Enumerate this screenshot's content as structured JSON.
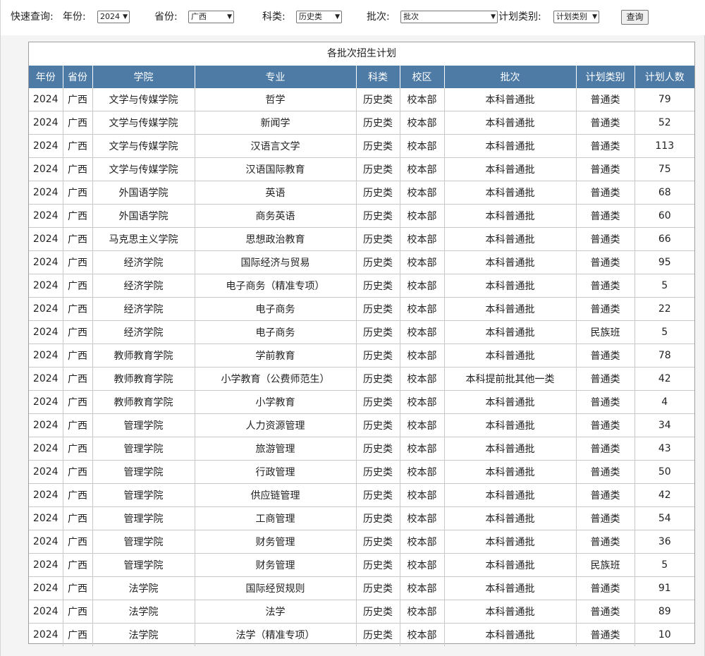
{
  "filter": {
    "quick_label": "快速查询:",
    "year_label": "年份:",
    "year_value": "2024",
    "province_label": "省份:",
    "province_value": "广西",
    "subject_label": "科类:",
    "subject_value": "历史类",
    "batch_label": "批次:",
    "batch_value": "批次",
    "plan_type_label": "计划类别:",
    "plan_type_value": "计划类别",
    "query_button": "查询"
  },
  "table": {
    "caption": "各批次招生计划",
    "headers": [
      "年份",
      "省份",
      "学院",
      "专业",
      "科类",
      "校区",
      "批次",
      "计划类别",
      "计划人数"
    ],
    "rows": [
      [
        "2024",
        "广西",
        "文学与传媒学院",
        "哲学",
        "历史类",
        "校本部",
        "本科普通批",
        "普通类",
        "79"
      ],
      [
        "2024",
        "广西",
        "文学与传媒学院",
        "新闻学",
        "历史类",
        "校本部",
        "本科普通批",
        "普通类",
        "52"
      ],
      [
        "2024",
        "广西",
        "文学与传媒学院",
        "汉语言文学",
        "历史类",
        "校本部",
        "本科普通批",
        "普通类",
        "113"
      ],
      [
        "2024",
        "广西",
        "文学与传媒学院",
        "汉语国际教育",
        "历史类",
        "校本部",
        "本科普通批",
        "普通类",
        "75"
      ],
      [
        "2024",
        "广西",
        "外国语学院",
        "英语",
        "历史类",
        "校本部",
        "本科普通批",
        "普通类",
        "68"
      ],
      [
        "2024",
        "广西",
        "外国语学院",
        "商务英语",
        "历史类",
        "校本部",
        "本科普通批",
        "普通类",
        "60"
      ],
      [
        "2024",
        "广西",
        "马克思主义学院",
        "思想政治教育",
        "历史类",
        "校本部",
        "本科普通批",
        "普通类",
        "66"
      ],
      [
        "2024",
        "广西",
        "经济学院",
        "国际经济与贸易",
        "历史类",
        "校本部",
        "本科普通批",
        "普通类",
        "95"
      ],
      [
        "2024",
        "广西",
        "经济学院",
        "电子商务（精准专项）",
        "历史类",
        "校本部",
        "本科普通批",
        "普通类",
        "5"
      ],
      [
        "2024",
        "广西",
        "经济学院",
        "电子商务",
        "历史类",
        "校本部",
        "本科普通批",
        "普通类",
        "22"
      ],
      [
        "2024",
        "广西",
        "经济学院",
        "电子商务",
        "历史类",
        "校本部",
        "本科普通批",
        "民族班",
        "5"
      ],
      [
        "2024",
        "广西",
        "教师教育学院",
        "学前教育",
        "历史类",
        "校本部",
        "本科普通批",
        "普通类",
        "78"
      ],
      [
        "2024",
        "广西",
        "教师教育学院",
        "小学教育（公费师范生）",
        "历史类",
        "校本部",
        "本科提前批其他一类",
        "普通类",
        "42"
      ],
      [
        "2024",
        "广西",
        "教师教育学院",
        "小学教育",
        "历史类",
        "校本部",
        "本科普通批",
        "普通类",
        "4"
      ],
      [
        "2024",
        "广西",
        "管理学院",
        "人力资源管理",
        "历史类",
        "校本部",
        "本科普通批",
        "普通类",
        "34"
      ],
      [
        "2024",
        "广西",
        "管理学院",
        "旅游管理",
        "历史类",
        "校本部",
        "本科普通批",
        "普通类",
        "43"
      ],
      [
        "2024",
        "广西",
        "管理学院",
        "行政管理",
        "历史类",
        "校本部",
        "本科普通批",
        "普通类",
        "50"
      ],
      [
        "2024",
        "广西",
        "管理学院",
        "供应链管理",
        "历史类",
        "校本部",
        "本科普通批",
        "普通类",
        "42"
      ],
      [
        "2024",
        "广西",
        "管理学院",
        "工商管理",
        "历史类",
        "校本部",
        "本科普通批",
        "普通类",
        "54"
      ],
      [
        "2024",
        "广西",
        "管理学院",
        "财务管理",
        "历史类",
        "校本部",
        "本科普通批",
        "普通类",
        "36"
      ],
      [
        "2024",
        "广西",
        "管理学院",
        "财务管理",
        "历史类",
        "校本部",
        "本科普通批",
        "民族班",
        "5"
      ],
      [
        "2024",
        "广西",
        "法学院",
        "国际经贸规则",
        "历史类",
        "校本部",
        "本科普通批",
        "普通类",
        "91"
      ],
      [
        "2024",
        "广西",
        "法学院",
        "法学",
        "历史类",
        "校本部",
        "本科普通批",
        "普通类",
        "89"
      ],
      [
        "2024",
        "广西",
        "法学院",
        "法学（精准专项）",
        "历史类",
        "校本部",
        "本科普通批",
        "普通类",
        "10"
      ]
    ]
  }
}
